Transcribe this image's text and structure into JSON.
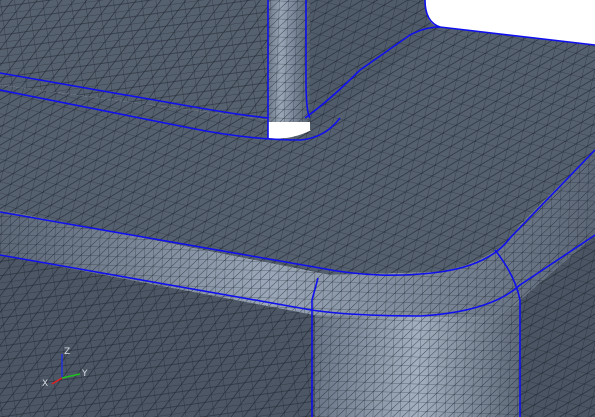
{
  "viewport": {
    "mode": "3D mesh view",
    "colors": {
      "background": "#ffffff",
      "surface_top": "#4f5a69",
      "surface_mid": "#5b6676",
      "surface_dark": "#3e4856",
      "surface_highlight": "#8f9cad",
      "mesh_line": "#1a2028",
      "edge_line": "#1010ee"
    }
  },
  "triad": {
    "x_label": "X",
    "y_label": "Y",
    "z_label": "Z",
    "x_color": "#e02020",
    "y_color": "#20c020",
    "z_color": "#2030e0"
  }
}
